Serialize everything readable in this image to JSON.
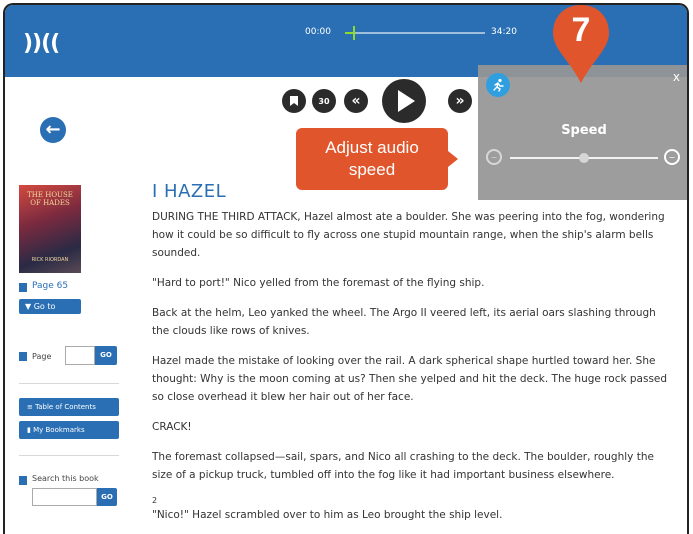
{
  "app": {
    "logo": "))(("
  },
  "player": {
    "time_start": "00:00",
    "time_end": "34:20",
    "progress": 0.06,
    "controls": {
      "bookmark_icon": "bookmark-icon",
      "skip_back_label": "30",
      "rewind_label": "«",
      "forward_label": "»"
    }
  },
  "speed_panel": {
    "title": "Speed",
    "close_label": "x",
    "speed_level": 0.5
  },
  "callout": {
    "line1": "Adjust audio",
    "line2": "speed",
    "step_number": "7",
    "color": "#e0552b"
  },
  "sidebar": {
    "cover": {
      "title": "THE HOUSE OF HADES",
      "author": "RICK RIORDAN"
    },
    "current_page": "Page 65",
    "goto_label": "▼ Go to",
    "page_label": "Page",
    "go_label": "GO",
    "toc_label": "Table of Contents",
    "bookmarks_label": "My Bookmarks",
    "search_label": "Search this book",
    "search_go_label": "GO"
  },
  "book": {
    "chapter": "I HAZEL",
    "paragraphs": [
      "DURING THE THIRD ATTACK, Hazel almost ate a boulder. She was peering into the fog, wondering how it could be so difficult to fly across one stupid mountain range, when the ship's alarm bells sounded.",
      "\"Hard to port!\" Nico yelled from the foremast of the flying ship.",
      "Back at the helm, Leo yanked the wheel. The Argo II veered left, its aerial oars slashing through the clouds like rows of knives.",
      "Hazel made the mistake of looking over the rail. A dark spherical shape hurtled toward her. She thought: Why is the moon coming at us? Then she yelped and hit the deck. The huge rock passed so close overhead it blew her hair out of her face.",
      "CRACK!",
      "The foremast collapsed—sail, spars, and Nico all crashing to the deck. The boulder, roughly the size of a pickup truck, tumbled off into the fog like it had important business elsewhere.",
      "\"Nico!\" Hazel scrambled over to him as Leo brought the ship level."
    ],
    "page_number": "2",
    "accent": "#2a6fb4"
  }
}
